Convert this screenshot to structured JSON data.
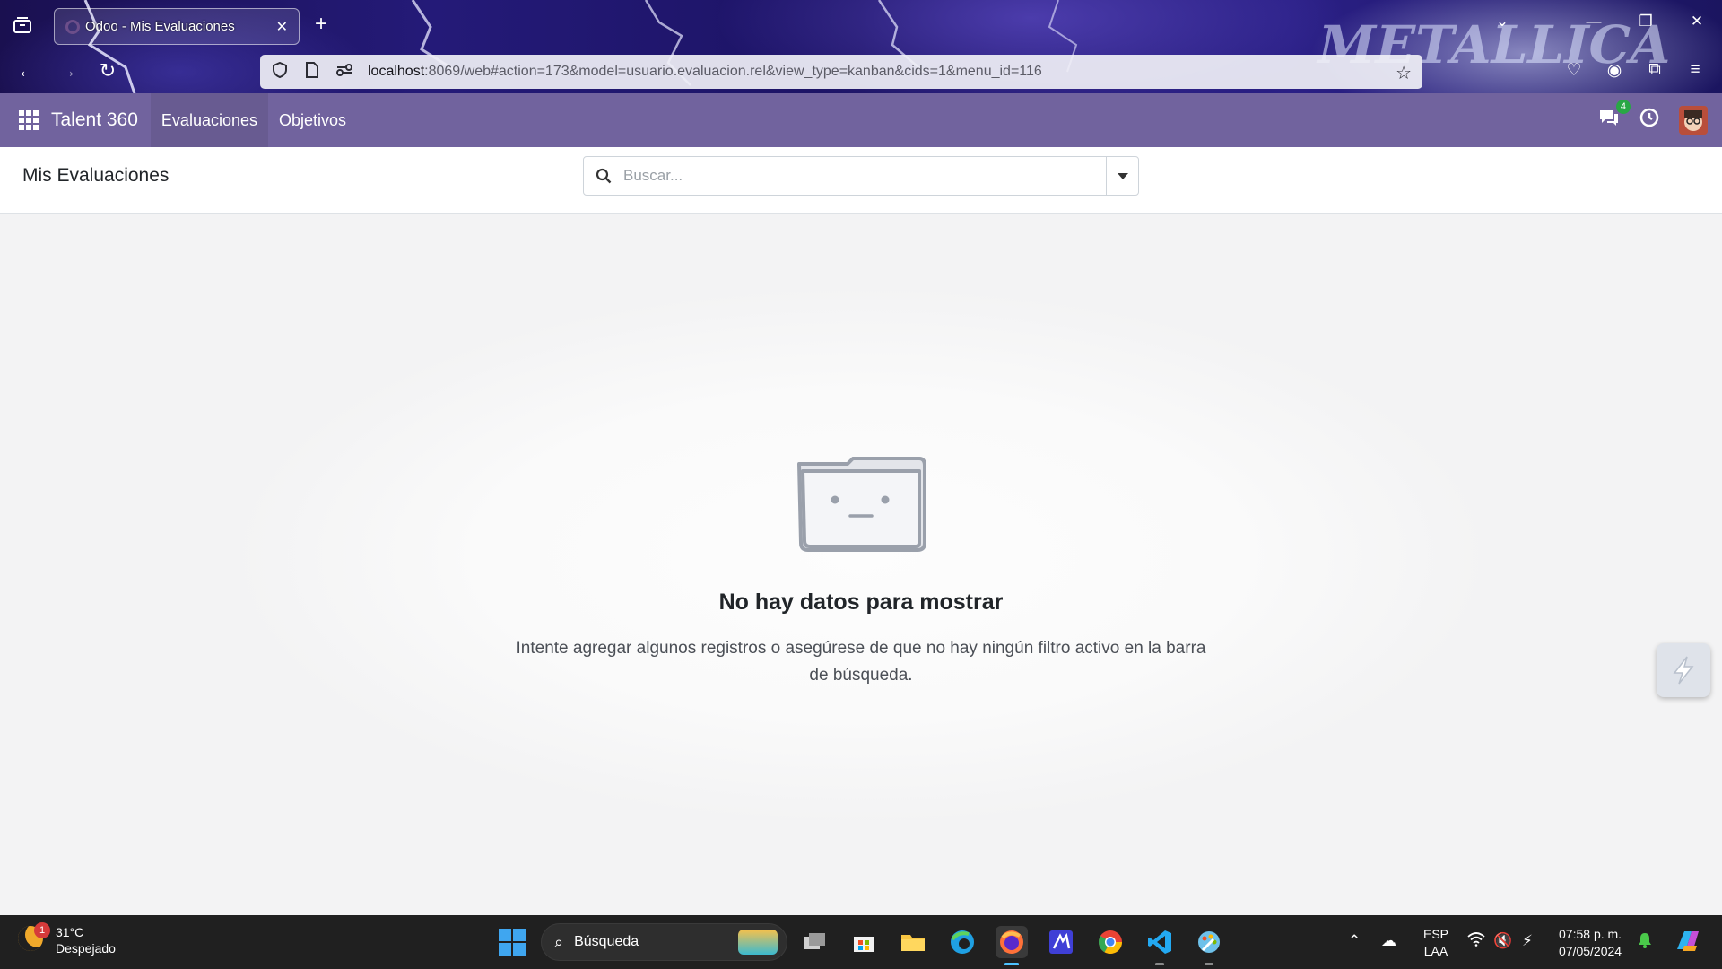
{
  "browser": {
    "tab_title": "Odoo - Mis Evaluaciones",
    "tab_close": "✕",
    "new_tab": "+",
    "url_host": "localhost",
    "url_path": ":8069/web#action=173&model=usuario.evaluacion.rel&view_type=kanban&cids=1&menu_id=116"
  },
  "odoo": {
    "app_name": "Talent 360",
    "menu": [
      {
        "label": "Evaluaciones",
        "active": true
      },
      {
        "label": "Objetivos",
        "active": false
      }
    ],
    "messages_badge": "4"
  },
  "control_panel": {
    "breadcrumb": "Mis Evaluaciones",
    "search_placeholder": "Buscar..."
  },
  "empty_state": {
    "title": "No hay datos para mostrar",
    "text": "Intente agregar algunos registros o asegúrese de que no hay ningún filtro activo en la barra de búsqueda."
  },
  "taskbar": {
    "weather_temp": "31°C",
    "weather_desc": "Despejado",
    "weather_alert": "1",
    "search_label": "Búsqueda",
    "lang_line1": "ESP",
    "lang_line2": "LAA",
    "time": "07:58 p. m.",
    "date": "07/05/2024"
  },
  "colors": {
    "odoo_navbar": "#71639e",
    "badge": "#28a745",
    "taskbar": "#202020"
  }
}
